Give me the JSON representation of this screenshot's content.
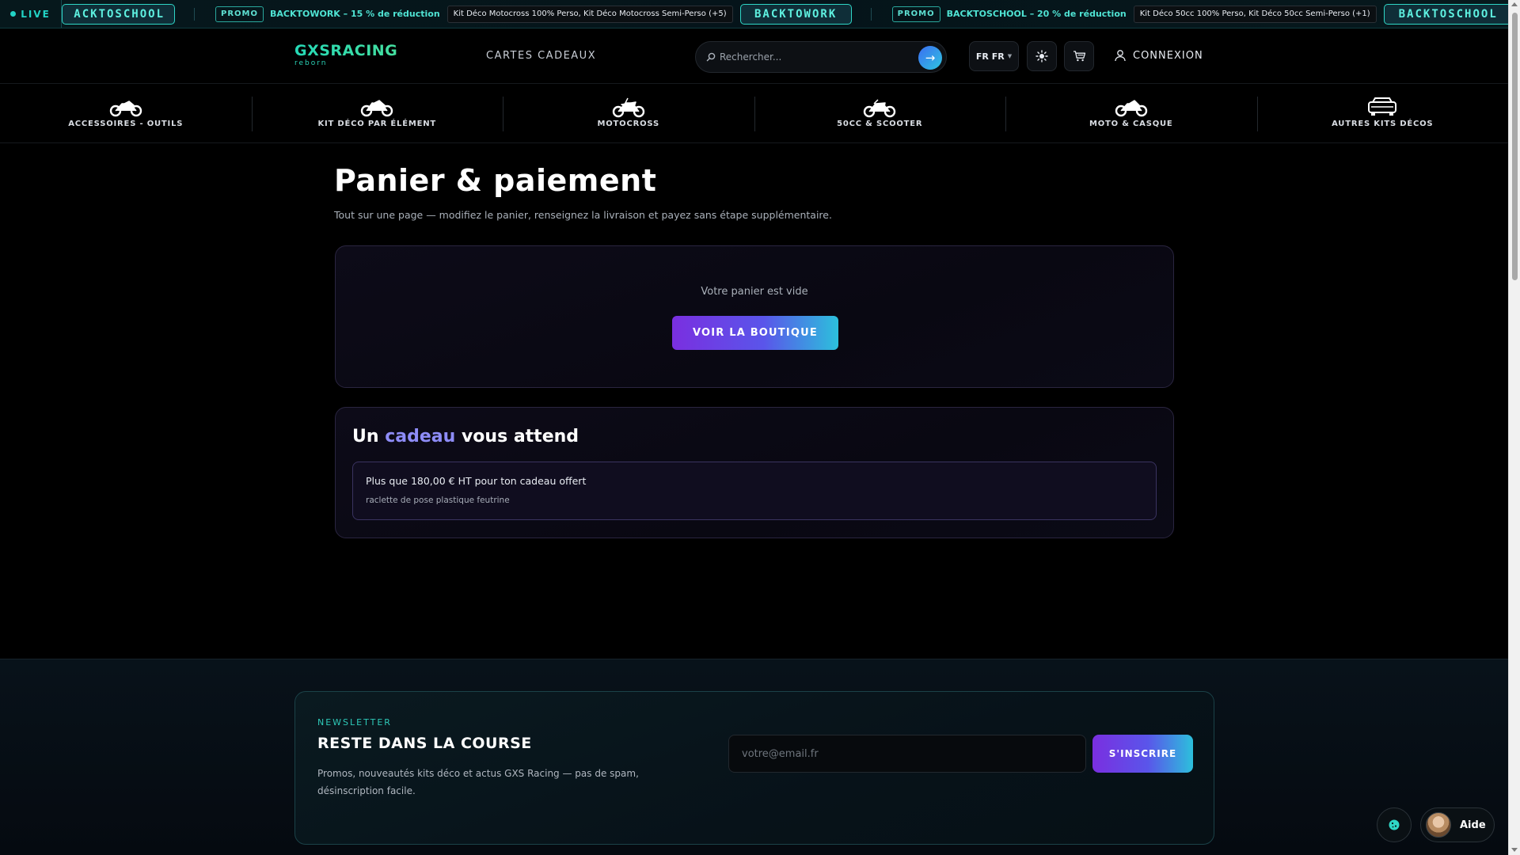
{
  "ticker": {
    "live_label": "LIVE",
    "code_partial": "ACKTOSCHOOL",
    "items": [
      {
        "promo_label": "PROMO",
        "text": "BACKTOWORK – 15 % de réduction",
        "products": "Kit Déco Motocross 100% Perso, Kit Déco Motocross Semi-Perso (+5)",
        "code": "BACKTOWORK"
      },
      {
        "promo_label": "PROMO",
        "text": "BACKTOSCHOOL – 20 % de réduction",
        "products": "Kit Déco 50cc 100% Perso, Kit Déco 50cc Semi-Perso (+1)",
        "code": "BACKTOSCHOOL"
      }
    ]
  },
  "header": {
    "logo_main": "GXSRACING",
    "logo_sub": "reborn",
    "gift_cards_link": "CARTES CADEAUX",
    "search_placeholder": "Rechercher...",
    "language": "FR FR",
    "login_label": "CONNEXION"
  },
  "categories": [
    {
      "label": "ACCESSOIRES - OUTILS",
      "icon": "sport-bike-icon"
    },
    {
      "label": "KIT DÉCO PAR ÉLÉMENT",
      "icon": "sport-bike-icon"
    },
    {
      "label": "MOTOCROSS",
      "icon": "motocross-bike-icon"
    },
    {
      "label": "50CC & SCOOTER",
      "icon": "dirt-bike-icon"
    },
    {
      "label": "MOTO & CASQUE",
      "icon": "sport-bike-icon"
    },
    {
      "label": "AUTRES KITS DÉCOS",
      "icon": "car-icon"
    }
  ],
  "main": {
    "title": "Panier & paiement",
    "subtitle": "Tout sur une page — modifiez le panier, renseignez la livraison et payez sans étape supplémentaire.",
    "cart": {
      "empty_text": "Votre panier est vide",
      "shop_button": "VOIR LA BOUTIQUE"
    },
    "gift": {
      "title_before": "Un",
      "title_highlight": "cadeau",
      "title_after": "vous attend",
      "line1": "Plus que 180,00 € HT pour ton cadeau offert",
      "line2": "raclette de pose plastique feutrine"
    }
  },
  "newsletter": {
    "eyebrow": "NEWSLETTER",
    "title": "RESTE DANS LA COURSE",
    "description": "Promos, nouveautés kits déco et actus GXS Racing — pas de spam, désinscription facile.",
    "email_placeholder": "votre@email.fr",
    "subscribe_button": "S'INSCRIRE"
  },
  "widgets": {
    "help_label": "Aide"
  },
  "colors": {
    "accent_teal": "#2fd6c6",
    "accent_violet": "#7a2fe0",
    "accent_blue": "#5a55ea",
    "gift_highlight": "#8e8cf7"
  }
}
